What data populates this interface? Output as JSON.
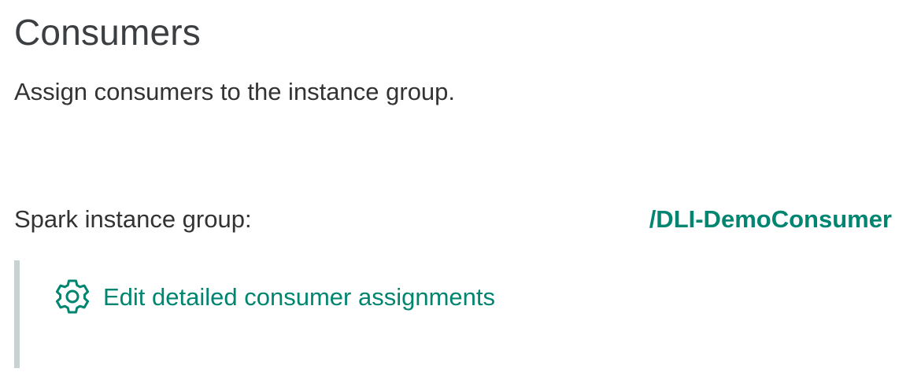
{
  "page": {
    "title": "Consumers",
    "description": "Assign consumers to the instance group."
  },
  "instance_group": {
    "label": "Spark instance group:",
    "value": "/DLI-DemoConsumer"
  },
  "edit_link": {
    "label": "Edit detailed consumer assignments",
    "icon": "gear-icon"
  },
  "colors": {
    "accent": "#008571",
    "text": "#333333",
    "panel_border": "#c8d2d2"
  }
}
